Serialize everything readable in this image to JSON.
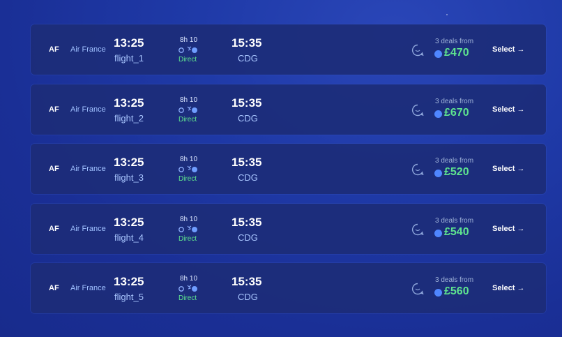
{
  "flights": [
    {
      "airline_code": "AF",
      "airline": "Air France",
      "dep_time": "13:25",
      "flight_id": "flight_1",
      "duration": "8h 10",
      "stops": "Direct",
      "arr_time": "15:35",
      "arr_airport": "CDG",
      "deals": "3 deals from",
      "price": "£470",
      "select": "Select →"
    },
    {
      "airline_code": "AF",
      "airline": "Air France",
      "dep_time": "13:25",
      "flight_id": "flight_2",
      "duration": "8h 10",
      "stops": "Direct",
      "arr_time": "15:35",
      "arr_airport": "CDG",
      "deals": "3 deals from",
      "price": "£670",
      "select": "Select →"
    },
    {
      "airline_code": "AF",
      "airline": "Air France",
      "dep_time": "13:25",
      "flight_id": "flight_3",
      "duration": "8h 10",
      "stops": "Direct",
      "arr_time": "15:35",
      "arr_airport": "CDG",
      "deals": "3 deals from",
      "price": "£520",
      "select": "Select →"
    },
    {
      "airline_code": "AF",
      "airline": "Air France",
      "dep_time": "13:25",
      "flight_id": "flight_4",
      "duration": "8h 10",
      "stops": "Direct",
      "arr_time": "15:35",
      "arr_airport": "CDG",
      "deals": "3 deals from",
      "price": "£540",
      "select": "Select →"
    },
    {
      "airline_code": "AF",
      "airline": "Air France",
      "dep_time": "13:25",
      "flight_id": "flight_5",
      "duration": "8h 10",
      "stops": "Direct",
      "arr_time": "15:35",
      "arr_airport": "CDG",
      "deals": "3 deals from",
      "price": "£560",
      "select": "Select →"
    }
  ],
  "icons": {
    "route": "route-plane-icon",
    "chat": "chat-bubble-icon",
    "provider": "provider-dot-icon"
  },
  "colors": {
    "background": "#1f3aa8",
    "card": "#1c2d78",
    "price": "#5ee38f",
    "direct": "#5ee38f",
    "accent": "#4f86ff",
    "airline": "#9fc0ff"
  }
}
